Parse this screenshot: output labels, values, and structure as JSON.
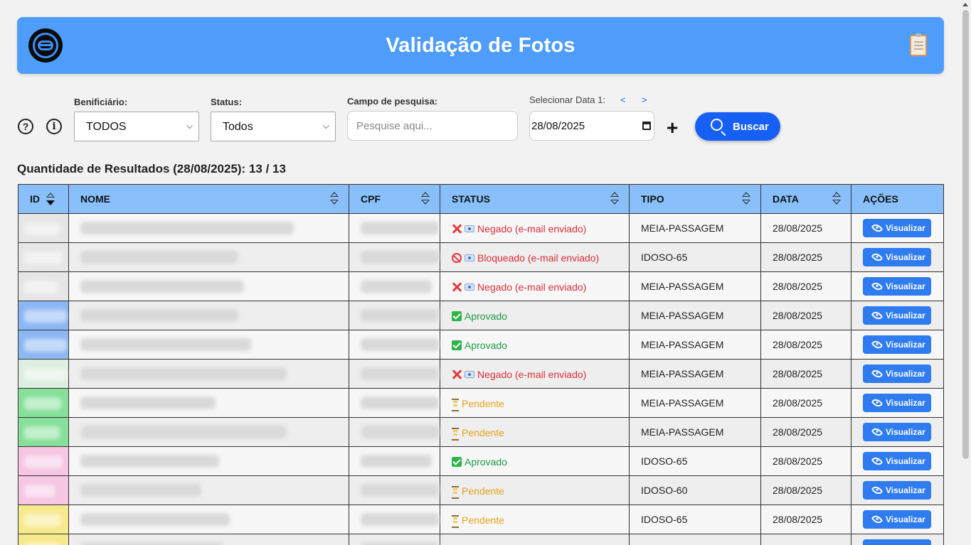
{
  "header": {
    "title": "Validação de Fotos",
    "logo_icon": "logo-icon",
    "clipboard_icon": "clipboard-icon"
  },
  "filters": {
    "beneficiario_label": "Benificiário:",
    "beneficiario_value": "TODOS",
    "status_label": "Status:",
    "status_value": "Todos",
    "search_label": "Campo de pesquisa:",
    "search_placeholder": "Pesquise aqui...",
    "date_label": "Selecionar Data 1:",
    "date_prev": "<",
    "date_next": ">",
    "date_value": "28/08/2025",
    "add_label": "+",
    "search_button": "Buscar",
    "help_icon": "?",
    "info_icon": "i"
  },
  "results": {
    "label": "Quantidade de Resultados (28/08/2025): 13 / 13"
  },
  "table": {
    "columns": [
      "ID",
      "NOME",
      "CPF",
      "STATUS",
      "TIPO",
      "DATA",
      "AÇÕES"
    ],
    "action_label": "Visualizar",
    "rows": [
      {
        "id_color": "#e6e6e6",
        "status": "Negado (e-mail enviado)",
        "status_kind": "negado",
        "tipo": "MEIA-PASSAGEM",
        "data": "28/08/2025"
      },
      {
        "id_color": "#e6e6e6",
        "status": "Bloqueado (e-mail enviado)",
        "status_kind": "bloqueado",
        "tipo": "IDOSO-65",
        "data": "28/08/2025"
      },
      {
        "id_color": "#e6e6e6",
        "status": "Negado (e-mail enviado)",
        "status_kind": "negado",
        "tipo": "MEIA-PASSAGEM",
        "data": "28/08/2025"
      },
      {
        "id_color": "#8bb7f4",
        "status": "Aprovado",
        "status_kind": "aprovado",
        "tipo": "MEIA-PASSAGEM",
        "data": "28/08/2025"
      },
      {
        "id_color": "#8bb7f4",
        "status": "Aprovado",
        "status_kind": "aprovado",
        "tipo": "MEIA-PASSAGEM",
        "data": "28/08/2025"
      },
      {
        "id_color": "#dcefe0",
        "status": "Negado (e-mail enviado)",
        "status_kind": "negado",
        "tipo": "MEIA-PASSAGEM",
        "data": "28/08/2025"
      },
      {
        "id_color": "#86e09a",
        "status": "Pendente",
        "status_kind": "pendente",
        "tipo": "MEIA-PASSAGEM",
        "data": "28/08/2025"
      },
      {
        "id_color": "#86e09a",
        "status": "Pendente",
        "status_kind": "pendente",
        "tipo": "MEIA-PASSAGEM",
        "data": "28/08/2025"
      },
      {
        "id_color": "#f6c6e2",
        "status": "Aprovado",
        "status_kind": "aprovado",
        "tipo": "IDOSO-65",
        "data": "28/08/2025"
      },
      {
        "id_color": "#f6c6e2",
        "status": "Pendente",
        "status_kind": "pendente",
        "tipo": "IDOSO-60",
        "data": "28/08/2025"
      },
      {
        "id_color": "#f7ea8c",
        "status": "Pendente",
        "status_kind": "pendente",
        "tipo": "IDOSO-65",
        "data": "28/08/2025"
      },
      {
        "id_color": "#f7ea8c",
        "status": "",
        "status_kind": "pendente",
        "tipo": "",
        "data": ""
      }
    ]
  }
}
